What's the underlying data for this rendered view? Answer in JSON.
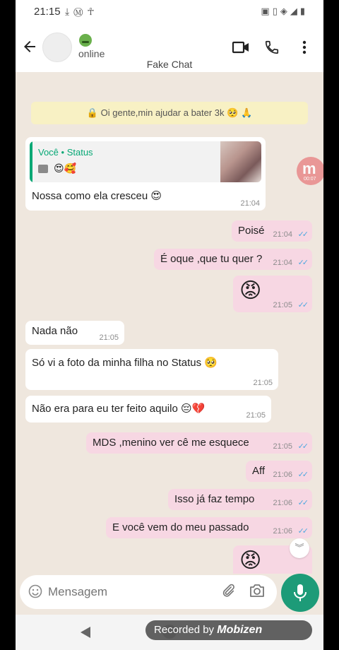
{
  "statusbar": {
    "time": "21:15",
    "left_icons": [
      "download-icon",
      "mobizen-icon",
      "accessibility-icon"
    ],
    "right_icons": [
      "no-sim-icon",
      "vibrate-icon",
      "wifi-icon",
      "signal-icon",
      "battery-icon"
    ]
  },
  "header": {
    "status": "online",
    "contact_name": "Fake Chat"
  },
  "system_message": "🔒 Oi gente,min ajudar a bater 3k 🥺 🙏",
  "messages": [
    {
      "dir": "in",
      "quote_name": "Você • Status",
      "quote_emoji": "😍🥰",
      "text": "Nossa como ela cresceu 😍",
      "time": "21:04"
    },
    {
      "dir": "out",
      "text": "Poisé",
      "time": "21:04",
      "ticks": "✓✓"
    },
    {
      "dir": "out",
      "text": "É oque ,que tu quer ?",
      "time": "21:04",
      "ticks": "✓✓"
    },
    {
      "dir": "out",
      "text": "😡",
      "time": "21:05",
      "ticks": "✓✓"
    },
    {
      "dir": "in",
      "text": "Nada não",
      "time": "21:05"
    },
    {
      "dir": "in",
      "text": "Só vi a foto da minha filha no Status 🥺",
      "time": "21:05"
    },
    {
      "dir": "in",
      "text": "Não era para eu ter feito aquilo 😔💔",
      "time": "21:05"
    },
    {
      "dir": "out",
      "text": "MDS ,menino ver cê me esquece",
      "time": "21:05",
      "ticks": "✓✓"
    },
    {
      "dir": "out",
      "text": "Aff",
      "time": "21:06",
      "ticks": "✓✓"
    },
    {
      "dir": "out",
      "text": "Isso já faz tempo",
      "time": "21:06",
      "ticks": "✓✓"
    },
    {
      "dir": "out",
      "text": "E você vem do meu passado",
      "time": "21:06",
      "ticks": "✓✓"
    },
    {
      "dir": "out",
      "text": "😡"
    }
  ],
  "recording_badge": {
    "letter": "m",
    "time": "00:07"
  },
  "composer": {
    "placeholder": "Mensagem"
  },
  "navbar": {
    "recorded_label": "Recorded by",
    "recorder_brand": "Mobizen"
  },
  "colors": {
    "incoming_bubble": "#ffffff",
    "outgoing_bubble": "#f7d7e3",
    "accent_green": "#1d9b78",
    "tick_blue": "#4fa8e0",
    "chat_bg": "#efe7de"
  }
}
